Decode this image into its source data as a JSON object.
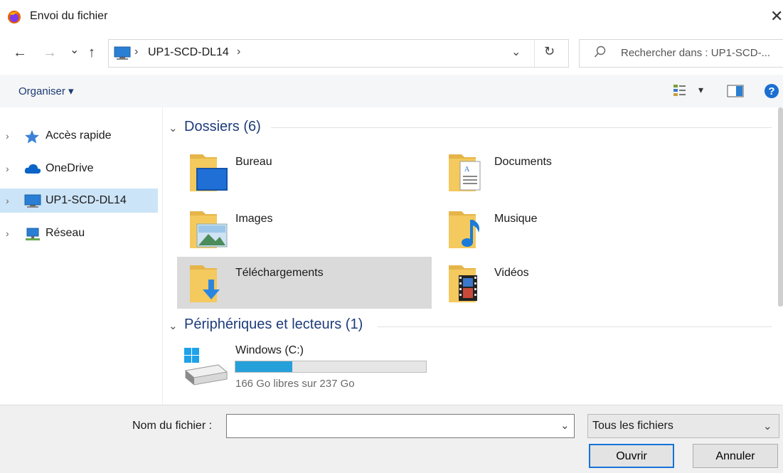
{
  "window": {
    "title": "Envoi du fichier",
    "close": "✕"
  },
  "nav": {
    "back": "←",
    "forward": "→",
    "recent": "⌄",
    "up": "↑",
    "address": "UP1-SCD-DL14",
    "chevron": "›",
    "dropdown": "⌄",
    "refresh": "↻",
    "search_placeholder": "Rechercher dans : UP1-SCD-..."
  },
  "toolbar": {
    "organise": "Organiser ▾",
    "view_dropdown": "▾"
  },
  "sidebar": {
    "items": [
      {
        "label": "Accès rapide",
        "icon": "star-icon"
      },
      {
        "label": "OneDrive",
        "icon": "cloud-icon"
      },
      {
        "label": "UP1-SCD-DL14",
        "icon": "computer-icon",
        "selected": true
      },
      {
        "label": "Réseau",
        "icon": "network-icon"
      }
    ],
    "chevron": "›"
  },
  "content": {
    "group_chevron": "⌄",
    "folders_title": "Dossiers (6)",
    "folders": [
      {
        "label": "Bureau",
        "icon": "desktop-folder-icon"
      },
      {
        "label": "Documents",
        "icon": "documents-folder-icon"
      },
      {
        "label": "Images",
        "icon": "pictures-folder-icon"
      },
      {
        "label": "Musique",
        "icon": "music-folder-icon"
      },
      {
        "label": "Téléchargements",
        "icon": "downloads-folder-icon",
        "selected": true
      },
      {
        "label": "Vidéos",
        "icon": "videos-folder-icon"
      }
    ],
    "devices_title": "Périphériques et lecteurs (1)",
    "drive": {
      "name": "Windows (C:)",
      "free_text": "166 Go libres sur 237 Go",
      "used_fraction": 0.3
    }
  },
  "footer": {
    "filename_label": "Nom du fichier :",
    "filename_value": "",
    "dropdown": "⌄",
    "filetype": "Tous les fichiers",
    "open": "Ouvrir",
    "cancel": "Annuler"
  },
  "colors": {
    "accent": "#1573d6",
    "selection": "#cce4f7",
    "drive_bar": "#26a0da",
    "folder": "#f4c95d"
  }
}
